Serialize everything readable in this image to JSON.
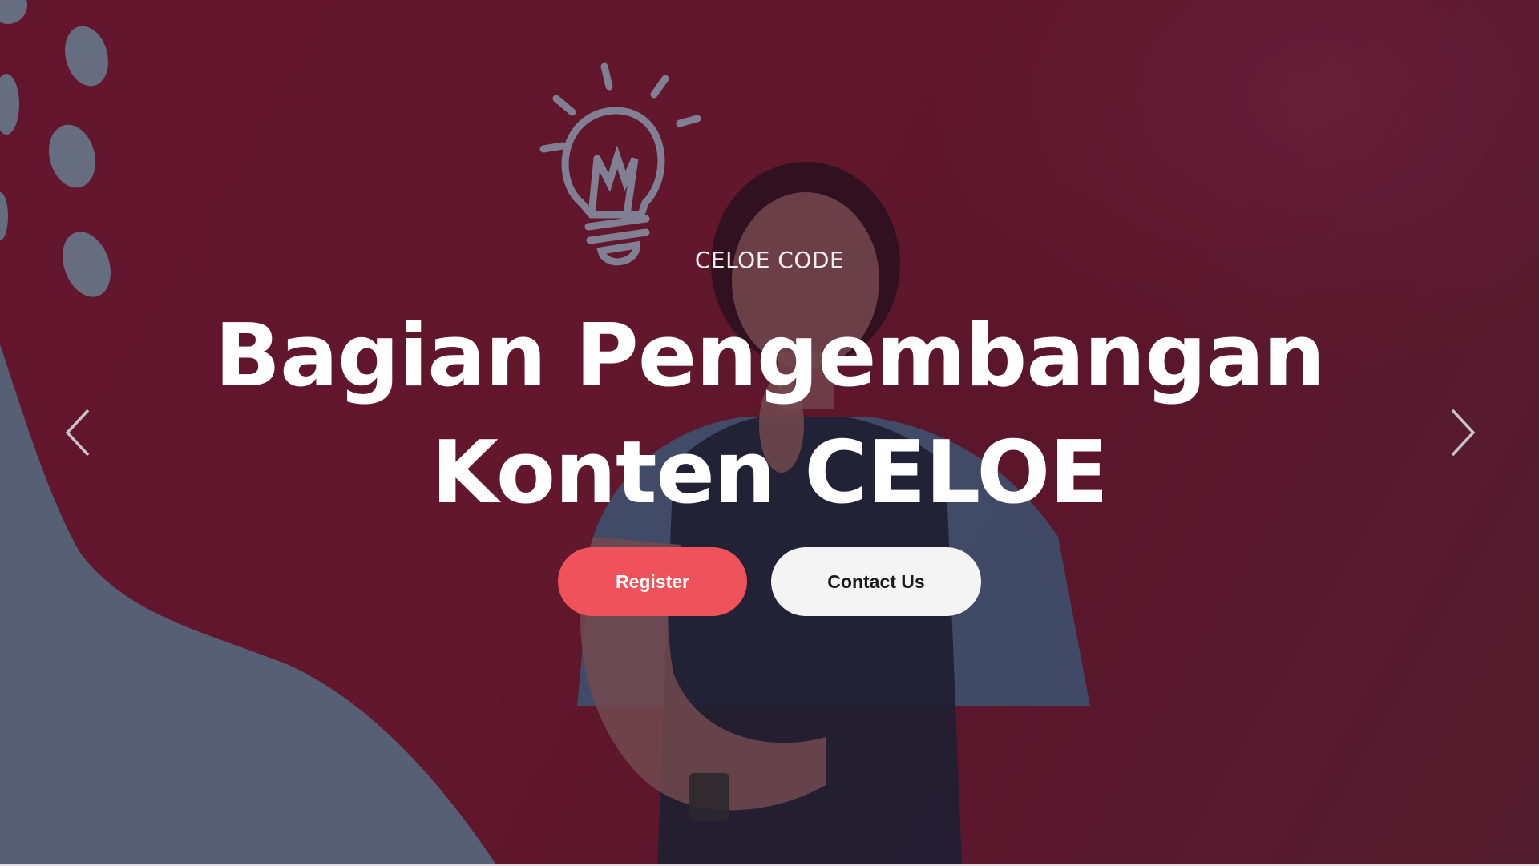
{
  "hero": {
    "subtitle": "CELOE CODE",
    "title_line1": "Bagian Pengembangan",
    "title_line2": "Konten CELOE",
    "background_color": "#6b1731",
    "accent_blob_color": "#5e6d80"
  },
  "buttons": {
    "register_label": "Register",
    "contact_label": "Contact Us",
    "register_color": "#f0525c",
    "contact_color": "#f4f4f4"
  },
  "carousel": {
    "prev_icon": "chevron-left-icon",
    "next_icon": "chevron-right-icon"
  },
  "decor": {
    "icon": "lightbulb-icon"
  }
}
